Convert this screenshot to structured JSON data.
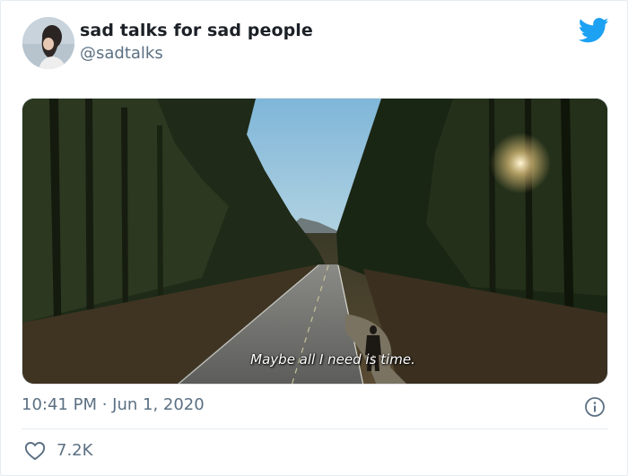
{
  "tweet": {
    "author_name": "sad talks for sad people",
    "author_handle": "@sadtalks",
    "media_caption": "Maybe all I need is time.",
    "timestamp": "10:41 PM · Jun 1, 2020",
    "like_count": "7.2K"
  },
  "icons": {
    "brand": "twitter-bird-icon",
    "info": "info-icon",
    "like": "heart-icon"
  },
  "colors": {
    "twitter_blue": "#1da1f2",
    "secondary_text": "#5b7083",
    "primary_text": "#1c2127"
  }
}
